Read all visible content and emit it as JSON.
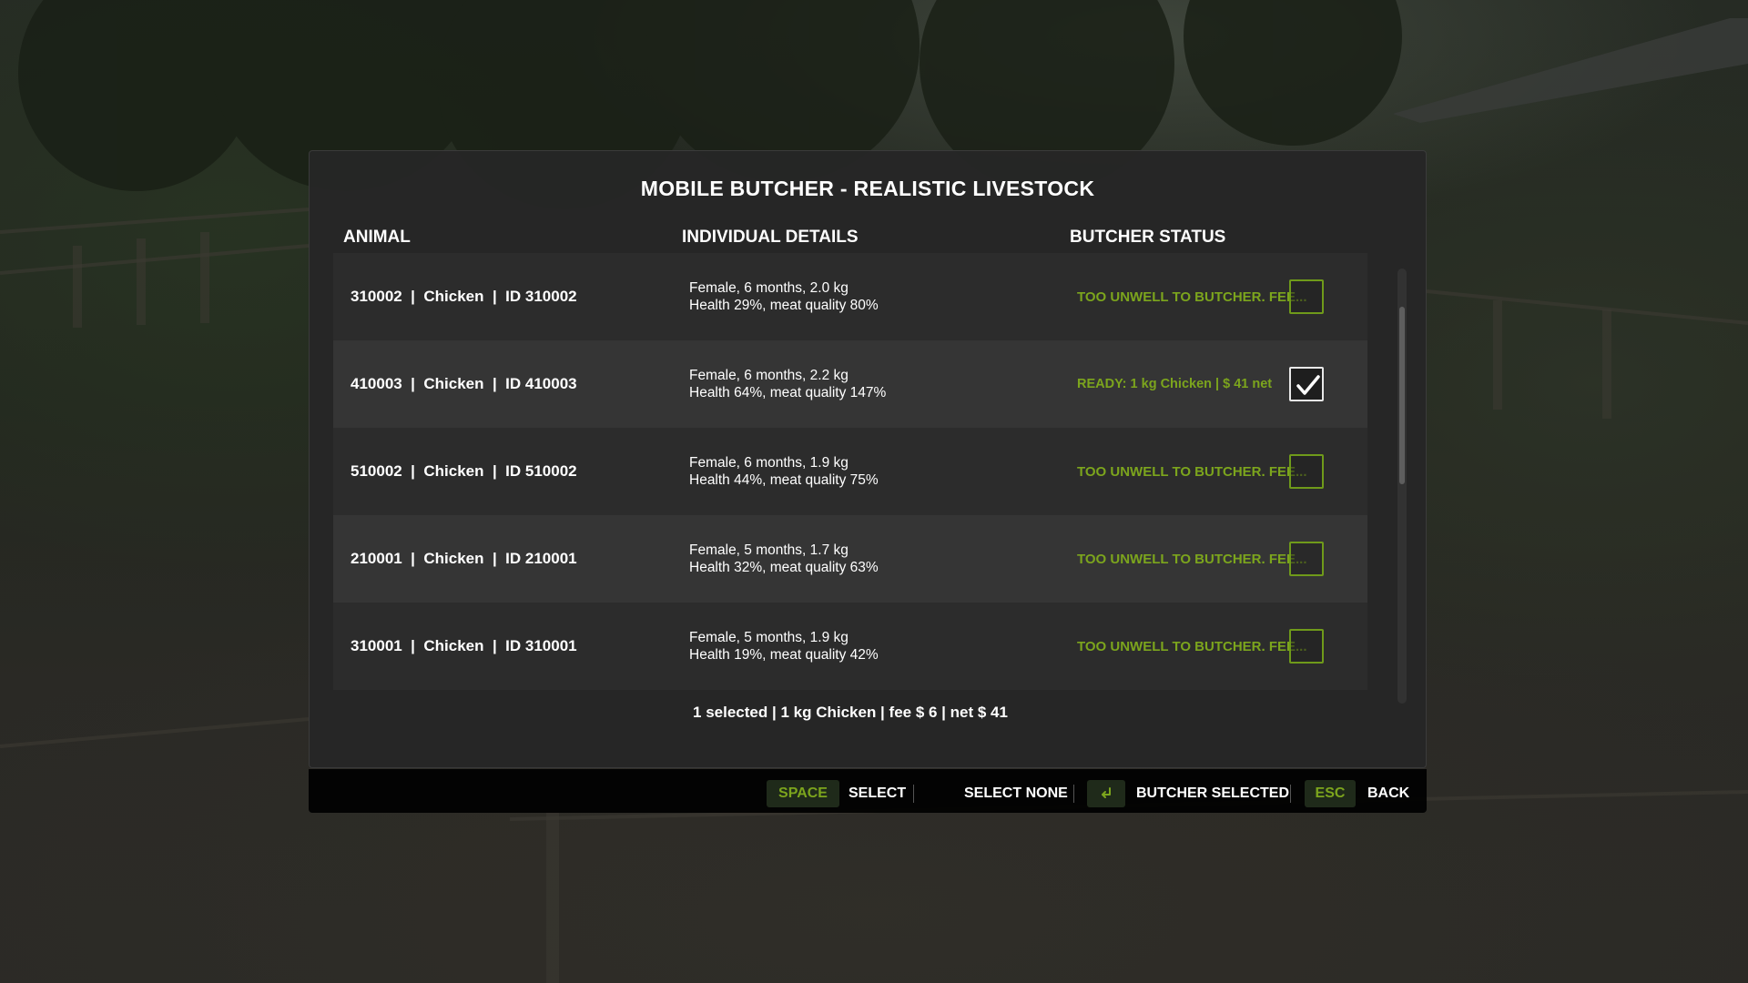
{
  "dialog": {
    "title": "MOBILE BUTCHER - REALISTIC LIVESTOCK",
    "columns": {
      "animal": "ANIMAL",
      "details": "INDIVIDUAL DETAILS",
      "status": "BUTCHER STATUS"
    },
    "rows": [
      {
        "animal": "310002  |  Chicken  |  ID 310002",
        "details_line1": "Female, 6 months, 2.0 kg",
        "details_line2": "Health 29%, meat quality 80%",
        "status": "TOO UNWELL TO BUTCHER. FEE...",
        "checked": false
      },
      {
        "animal": "410003  |  Chicken  |  ID 410003",
        "details_line1": "Female, 6 months, 2.2 kg",
        "details_line2": "Health 64%, meat quality 147%",
        "status": "READY: 1 kg Chicken | $ 41 net",
        "checked": true
      },
      {
        "animal": "510002  |  Chicken  |  ID 510002",
        "details_line1": "Female, 6 months, 1.9 kg",
        "details_line2": "Health 44%, meat quality 75%",
        "status": "TOO UNWELL TO BUTCHER. FEE...",
        "checked": false
      },
      {
        "animal": "210001  |  Chicken  |  ID 210001",
        "details_line1": "Female, 5 months, 1.7 kg",
        "details_line2": "Health 32%, meat quality 63%",
        "status": "TOO UNWELL TO BUTCHER. FEE...",
        "checked": false
      },
      {
        "animal": "310001  |  Chicken  |  ID 310001",
        "details_line1": "Female, 5 months, 1.9 kg",
        "details_line2": "Health 19%, meat quality 42%",
        "status": "TOO UNWELL TO BUTCHER. FEE...",
        "checked": false
      }
    ],
    "summary": "1 selected | 1 kg Chicken | fee $ 6 | net $ 41"
  },
  "footer": {
    "space_key": "SPACE",
    "select_label": "SELECT",
    "select_none_label": "SELECT NONE",
    "enter_key_icon": "enter-icon",
    "butcher_selected_label": "BUTCHER SELECTED",
    "esc_key": "ESC",
    "back_label": "BACK"
  },
  "colors": {
    "accent_green": "#7ca51d",
    "panel": "#262626",
    "row": "#2c2c2c",
    "row_alt": "#353535",
    "footer": "#000000"
  }
}
